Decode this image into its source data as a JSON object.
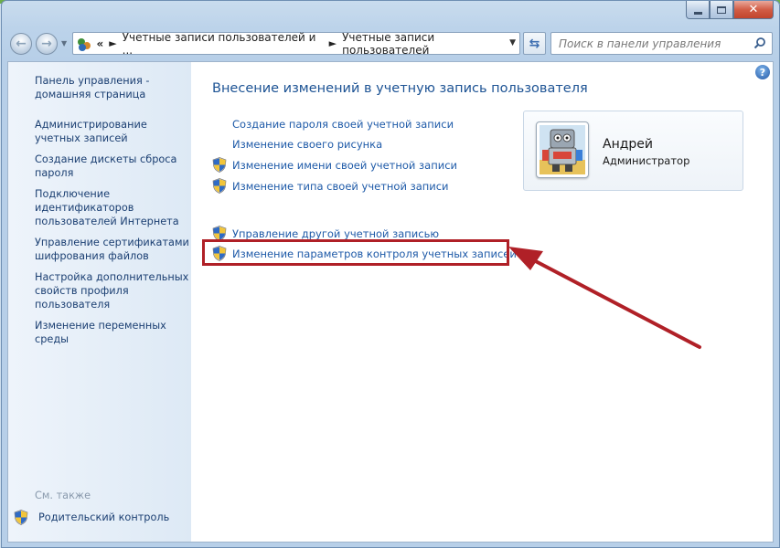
{
  "window": {
    "caption_buttons": {
      "minimize": "minimize",
      "maximize": "maximize",
      "close": "✕"
    }
  },
  "navbar": {
    "back_icon": "back-arrow-icon",
    "forward_icon": "forward-arrow-icon",
    "overflow": "«",
    "breadcrumb": [
      "Учетные записи пользователей и ...",
      "Учетные записи пользователей"
    ],
    "search_placeholder": "Поиск в панели управления"
  },
  "sidebar": {
    "items": [
      "Панель управления - домашняя страница",
      "Администрирование учетных записей",
      "Создание дискеты сброса пароля",
      "Подключение идентификаторов пользователей Интернета",
      "Управление сертификатами шифрования файлов",
      "Настройка дополнительных свойств профиля пользователя",
      "Изменение переменных среды"
    ],
    "see_also": "См. также",
    "parental_control": "Родительский контроль"
  },
  "main": {
    "title": "Внесение изменений в учетную запись пользователя",
    "tasks": [
      {
        "label": "Создание пароля своей учетной записи",
        "shield": false
      },
      {
        "label": "Изменение своего рисунка",
        "shield": false
      },
      {
        "label": "Изменение имени своей учетной записи",
        "shield": true
      },
      {
        "label": "Изменение типа своей учетной записи",
        "shield": true
      }
    ],
    "other_tasks": [
      {
        "label": "Управление другой учетной записью",
        "shield": true
      },
      {
        "label": "Изменение параметров контроля учетных записей",
        "shield": true,
        "highlighted": true
      }
    ]
  },
  "user": {
    "name": "Андрей",
    "role": "Администратор"
  },
  "colors": {
    "link": "#1e5aa8",
    "title": "#1d5394",
    "highlight": "#b02027"
  }
}
